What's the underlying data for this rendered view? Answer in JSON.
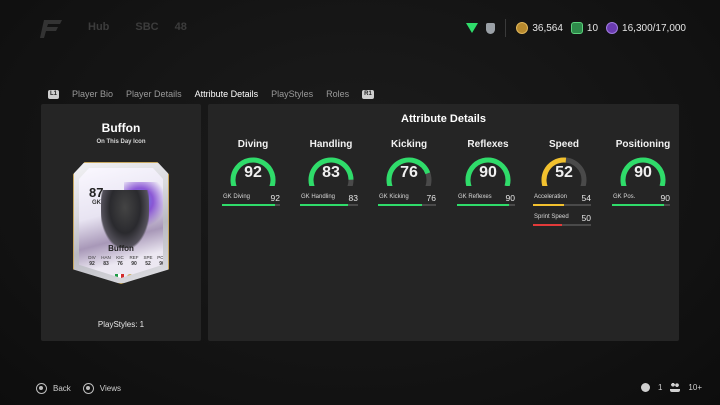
{
  "top": {
    "nav": [
      "Hub",
      "SBC",
      "48"
    ],
    "coins": "36,564",
    "points": "10",
    "sp": "16,300/17,000"
  },
  "tabs": {
    "left_bumper": "L1",
    "right_bumper": "R1",
    "items": [
      "Player Bio",
      "Player Details",
      "Attribute Details",
      "PlayStyles",
      "Roles"
    ],
    "active": "Attribute Details"
  },
  "player": {
    "name": "Buffon",
    "version": "On This Day Icon",
    "rating": "87",
    "position": "GK",
    "card_name": "Buffon",
    "card_stats": [
      {
        "k": "DIV",
        "v": "92"
      },
      {
        "k": "HAN",
        "v": "83"
      },
      {
        "k": "KIC",
        "v": "76"
      },
      {
        "k": "REF",
        "v": "90"
      },
      {
        "k": "SPE",
        "v": "52"
      },
      {
        "k": "POS",
        "v": "90"
      }
    ],
    "playstyles": "PlayStyles: 1"
  },
  "attributes": {
    "title": "Attribute Details",
    "colors": {
      "green": "#2fdc6a",
      "yellow": "#f2c12e",
      "red": "#e23a3a",
      "track": "#4a4a4a"
    },
    "groups": [
      {
        "name": "Diving",
        "value": 92,
        "color": "#2fdc6a",
        "subs": [
          {
            "label": "GK Diving",
            "value": 92,
            "color": "#2fdc6a"
          }
        ]
      },
      {
        "name": "Handling",
        "value": 83,
        "color": "#2fdc6a",
        "subs": [
          {
            "label": "GK Handling",
            "value": 83,
            "color": "#2fdc6a"
          }
        ]
      },
      {
        "name": "Kicking",
        "value": 76,
        "color": "#2fdc6a",
        "subs": [
          {
            "label": "GK Kicking",
            "value": 76,
            "color": "#2fdc6a"
          }
        ]
      },
      {
        "name": "Reflexes",
        "value": 90,
        "color": "#2fdc6a",
        "subs": [
          {
            "label": "GK Reflexes",
            "value": 90,
            "color": "#2fdc6a"
          }
        ]
      },
      {
        "name": "Speed",
        "value": 52,
        "color": "#f2c12e",
        "subs": [
          {
            "label": "Acceleration",
            "value": 54,
            "color": "#f2c12e"
          },
          {
            "label": "Sprint Speed",
            "value": 50,
            "color": "#e23a3a"
          }
        ]
      },
      {
        "name": "Positioning",
        "value": 90,
        "color": "#2fdc6a",
        "subs": [
          {
            "label": "GK Pos.",
            "value": 90,
            "color": "#2fdc6a"
          }
        ]
      }
    ]
  },
  "bottom": {
    "back": "Back",
    "views": "Views",
    "online": "1",
    "friends": "10+"
  }
}
